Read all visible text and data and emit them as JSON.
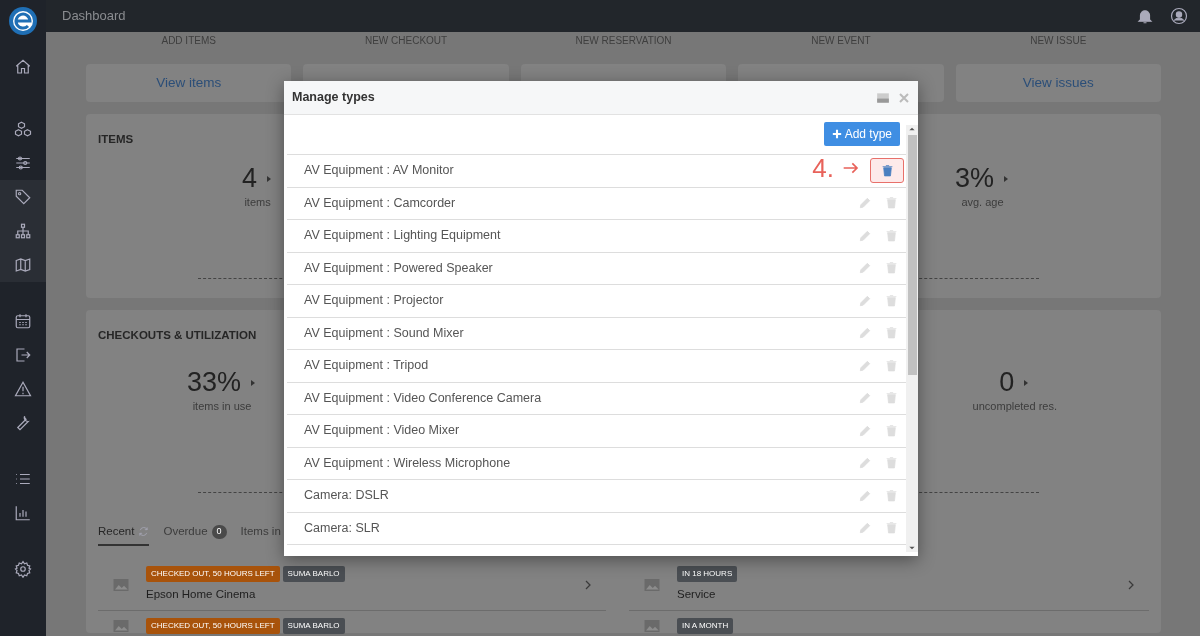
{
  "topbar": {
    "title": "Dashboard"
  },
  "quick_actions": [
    {
      "label": "ADD ITEMS",
      "link": "View items"
    },
    {
      "label": "NEW CHECKOUT"
    },
    {
      "label": "NEW RESERVATION"
    },
    {
      "label": "NEW EVENT"
    },
    {
      "label": "NEW ISSUE",
      "link": "View issues"
    }
  ],
  "items_card": {
    "title": "ITEMS",
    "stats": [
      {
        "value": "4",
        "label": "items"
      },
      {
        "value": "3%",
        "label": "avg. age"
      }
    ]
  },
  "checkouts_card": {
    "title": "CHECKOUTS & UTILIZATION",
    "stats": [
      {
        "value": "33%",
        "label": "items in use"
      },
      {
        "value": "0",
        "label": "uncompleted res."
      }
    ],
    "tabs": [
      {
        "label": "Recent",
        "selected": true
      },
      {
        "label": "Overdue",
        "count": "0",
        "selected": false
      },
      {
        "label": "Items in",
        "selected": false
      }
    ],
    "left_list": [
      {
        "badges": [
          {
            "text": "CHECKED OUT, 50 HOURS LEFT",
            "color": "#a8530b"
          },
          {
            "text": "SUMA BARLO",
            "color": "#4a4e53"
          }
        ],
        "title": "Epson Home Cinema"
      },
      {
        "badges": [
          {
            "text": "CHECKED OUT, 50 HOURS LEFT",
            "color": "#a8530b"
          },
          {
            "text": "SUMA BARLO",
            "color": "#4a4e53"
          }
        ]
      }
    ],
    "right_list": [
      {
        "badges": [
          {
            "text": "IN 18 HOURS",
            "color": "#4a4e53"
          }
        ],
        "title": "Service"
      },
      {
        "badges": [
          {
            "text": "IN A MONTH",
            "color": "#4a4e53"
          }
        ]
      }
    ]
  },
  "modal": {
    "title": "Manage types",
    "add_button": "Add type",
    "annotation": "4.",
    "rows": [
      {
        "label": "AV Equipment : AV Monitor",
        "highlighted": true
      },
      {
        "label": "AV Equipment : Camcorder",
        "highlighted": false
      },
      {
        "label": "AV Equipment : Lighting Equipment",
        "highlighted": false
      },
      {
        "label": "AV Equipment : Powered Speaker",
        "highlighted": false
      },
      {
        "label": "AV Equipment : Projector",
        "highlighted": false
      },
      {
        "label": "AV Equipment : Sound Mixer",
        "highlighted": false
      },
      {
        "label": "AV Equipment : Tripod",
        "highlighted": false
      },
      {
        "label": "AV Equipment : Video Conference Camera",
        "highlighted": false
      },
      {
        "label": "AV Equipment : Video Mixer",
        "highlighted": false
      },
      {
        "label": "AV Equipment : Wireless Microphone",
        "highlighted": false
      },
      {
        "label": "Camera: DSLR",
        "highlighted": false
      },
      {
        "label": "Camera: SLR",
        "highlighted": false
      }
    ]
  }
}
